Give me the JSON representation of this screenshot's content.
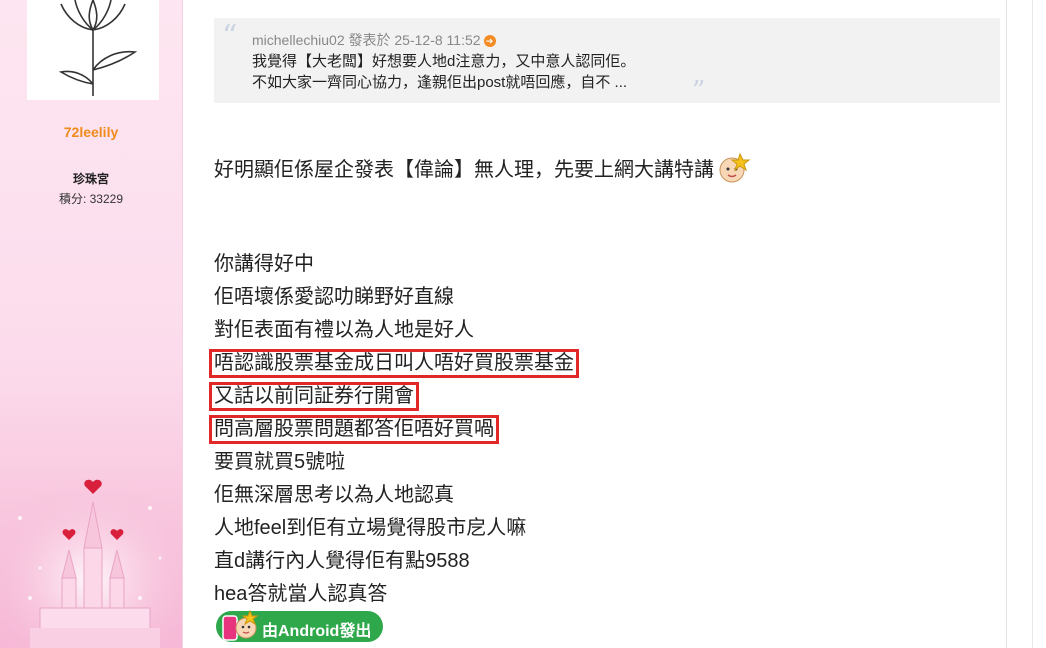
{
  "user": {
    "name": "72leelily",
    "group": "珍珠宮",
    "credits": "積分: 33229"
  },
  "quote": {
    "meta": "michellechiu02 發表於 25-12-8 11:52",
    "line1": "我覺得【大老闆】好想要人地d注意力，又中意人認同佢。",
    "line2": "不如大家一齊同心協力，逢親佢出post就唔回應，自不 ..."
  },
  "post": {
    "lead": "好明顯佢係屋企發表【偉論】無人理，先要上網大講特講",
    "lines": [
      "你講得好中",
      "佢唔壞係愛認叻睇野好直線",
      "對佢表面有禮以為人地是好人",
      "唔認識股票基金成日叫人唔好買股票基金",
      "又話以前同証券行開會",
      "問高層股票問題都答佢唔好買喎",
      "要買就買5號啦",
      "佢無深層思考以為人地認真",
      "人地feel到佢有立場覺得股市戹人嘛",
      "直d講行內人覺得佢有點9588",
      "hea答就當人認真答"
    ],
    "highlighted_lines": [
      3,
      4,
      5
    ],
    "highlight_color": "#e02828"
  },
  "badge": {
    "label": "由Android發出",
    "color": "#2fa84b"
  },
  "colors": {
    "username": "#f08a1c",
    "sidebar_bg": "#fde6f1",
    "quote_bg": "#f2f2f2"
  }
}
